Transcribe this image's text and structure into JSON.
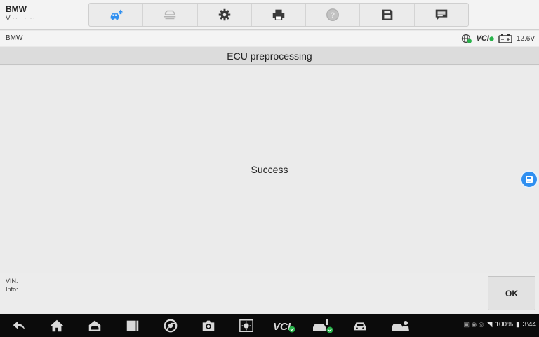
{
  "app": {
    "vehicle_make": "BMW",
    "vehicle_version": "V",
    "vehicle_version_obscured": "·· ·· ··"
  },
  "toolbar": {
    "items": [
      {
        "name": "vehicle-home-icon",
        "active": true
      },
      {
        "name": "vehicle-switch-icon",
        "active": false
      },
      {
        "name": "settings-icon",
        "active": false
      },
      {
        "name": "print-icon",
        "active": false
      },
      {
        "name": "help-icon",
        "active": false
      },
      {
        "name": "save-icon",
        "active": false
      },
      {
        "name": "message-icon",
        "active": false
      }
    ]
  },
  "status": {
    "breadcrumb": "BMW",
    "vci_label": "VCI",
    "voltage": "12.6V",
    "icons": [
      "globe-connected-icon",
      "vci-connected-icon",
      "battery-icon"
    ]
  },
  "page": {
    "title": "ECU preprocessing",
    "message": "Success"
  },
  "footer": {
    "vin_label": "VIN:",
    "info_label": "Info:",
    "ok_label": "OK"
  },
  "navbar": {
    "icons": [
      "back-icon",
      "home-icon",
      "autel-home-icon",
      "recent-apps-icon",
      "browser-icon",
      "camera-icon",
      "brightness-icon",
      "vci-status-icon",
      "vehicle-link-icon",
      "car-icon",
      "remote-desk-icon"
    ],
    "clock": "3:44",
    "battery": "100%"
  },
  "colors": {
    "accent": "#2f8ff0",
    "connected": "#28b34a",
    "background": "#ebebeb",
    "navbar": "#0b0b0b"
  }
}
